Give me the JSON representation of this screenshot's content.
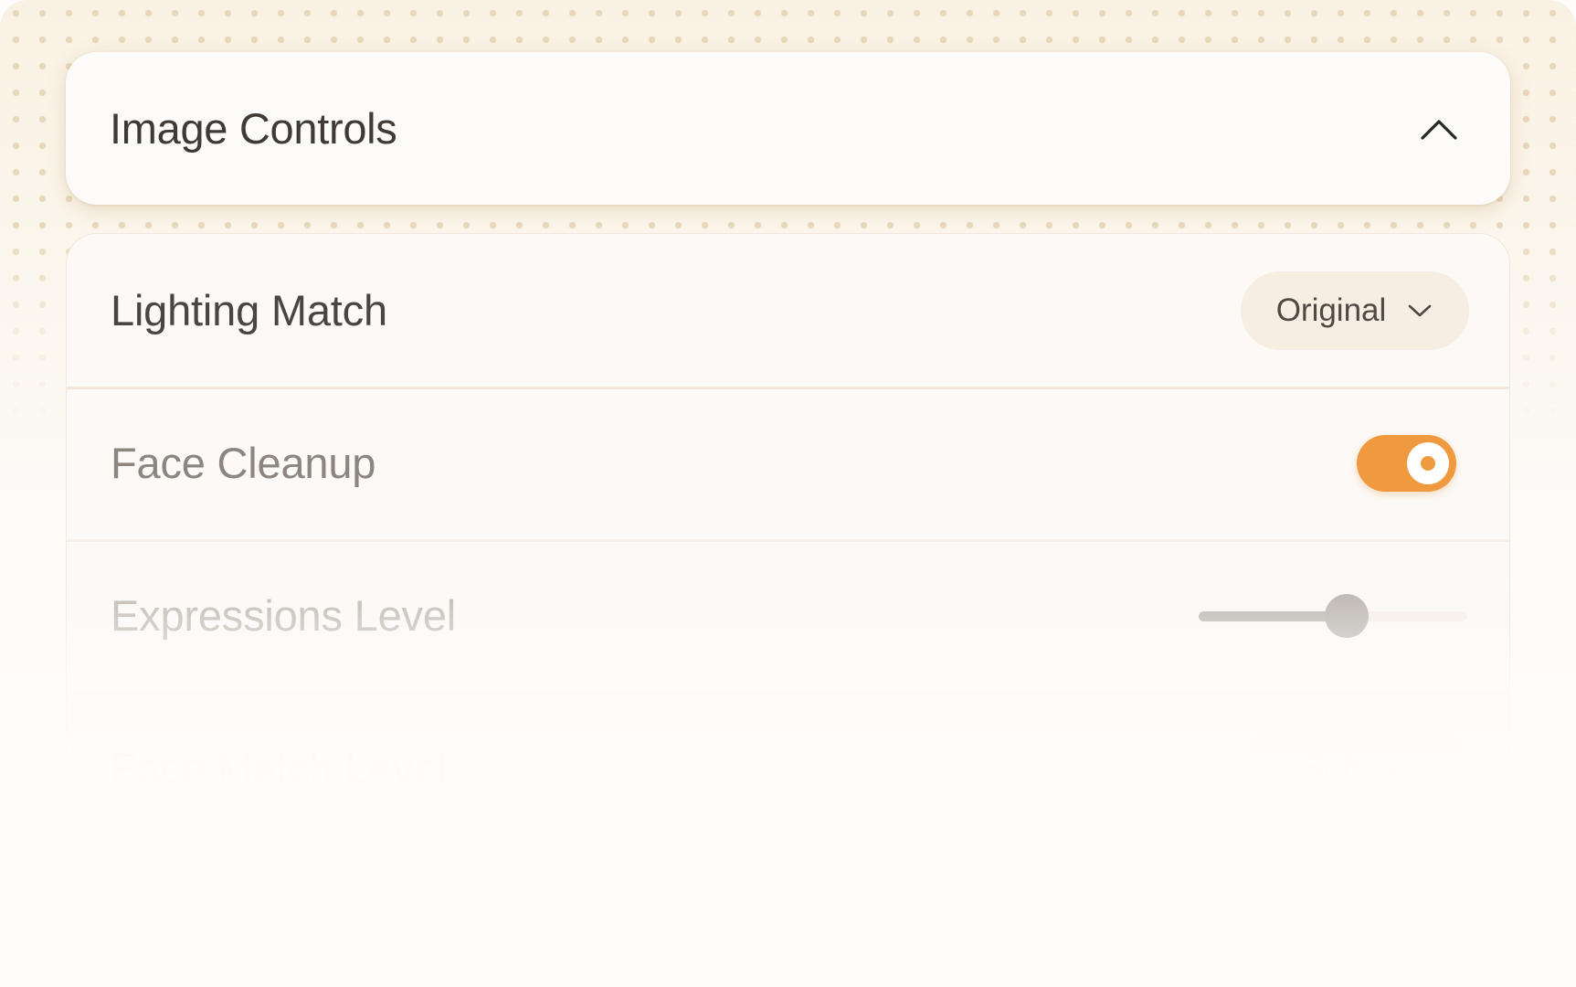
{
  "header": {
    "title": "Image Controls",
    "collapse_icon": "chevron-up-icon"
  },
  "settings": {
    "lighting_match": {
      "label": "Lighting Match",
      "value": "Original",
      "icon": "chevron-down-icon"
    },
    "face_cleanup": {
      "label": "Face Cleanup",
      "enabled": true
    },
    "expressions_level": {
      "label": "Expressions Level",
      "value_fraction": 0.55
    },
    "face_match_level": {
      "label": "Face Match Level",
      "value": "Soft",
      "icon": "chevron-down-icon"
    }
  },
  "colors": {
    "accent": "#ef9a3f",
    "text_primary": "#3f3a36",
    "dropdown_bg": "#f6eee2",
    "background": "#f9f2e4"
  }
}
